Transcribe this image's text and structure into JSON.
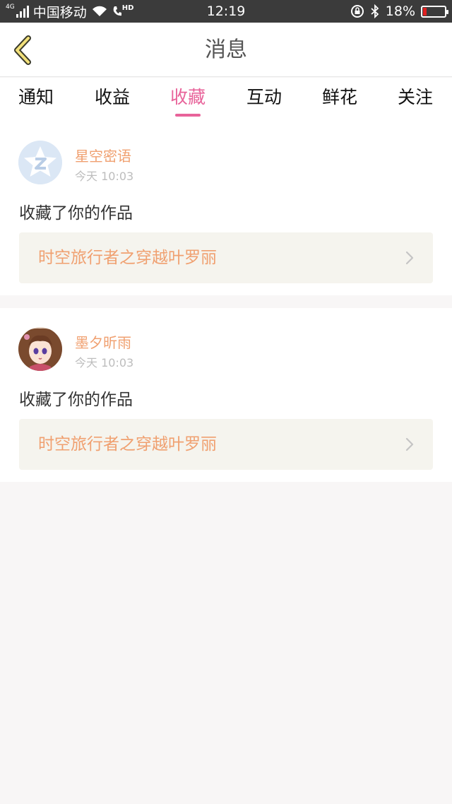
{
  "status_bar": {
    "network": "4G",
    "carrier": "中国移动",
    "hd": "HD",
    "time": "12:19",
    "battery": "18%",
    "battery_level": 0.18,
    "battery_color": "#e02020"
  },
  "header": {
    "back_icon": "chevron-left-icon",
    "title": "消息"
  },
  "tabs": [
    {
      "label": "通知",
      "active": false
    },
    {
      "label": "收益",
      "active": false
    },
    {
      "label": "收藏",
      "active": true
    },
    {
      "label": "互动",
      "active": false
    },
    {
      "label": "鲜花",
      "active": false
    },
    {
      "label": "关注",
      "active": false
    }
  ],
  "accent_color": "#e8639a",
  "messages": [
    {
      "username": "星空密语",
      "time": "今天 10:03",
      "action": "收藏了你的作品",
      "work_title": "时空旅行者之穿越叶罗丽",
      "avatar": "default-star-avatar"
    },
    {
      "username": "墨夕昕雨",
      "time": "今天 10:03",
      "action": "收藏了你的作品",
      "work_title": "时空旅行者之穿越叶罗丽",
      "avatar": "anime-girl-avatar"
    }
  ]
}
